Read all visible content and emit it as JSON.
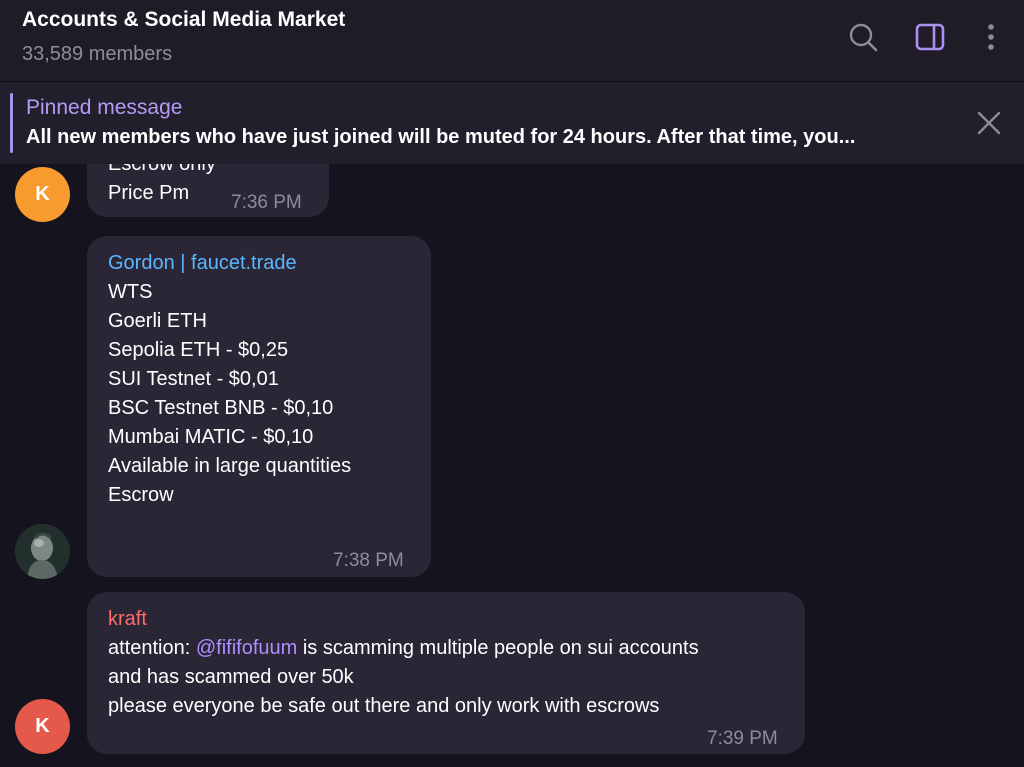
{
  "header": {
    "title": "Accounts & Social Media Market",
    "subtitle": "33,589 members"
  },
  "icons": {
    "search": "search-icon",
    "sidebar": "sidebar-toggle-icon",
    "more": "more-vertical-icon"
  },
  "colors": {
    "accent": "#a892f0",
    "sender_gordon": "#5cb6ff",
    "sender_kraft": "#ff6b6b",
    "mention": "#a891ff"
  },
  "pinned": {
    "title": "Pinned message",
    "text": "All new members who have just joined will be muted for 24 hours. After that time, you..."
  },
  "messages": [
    {
      "avatar": "K",
      "lines": [
        "Escrow only",
        "Price Pm"
      ],
      "time": "7:36 PM"
    },
    {
      "sender": "Gordon | faucet.trade",
      "lines": [
        "WTS",
        "",
        "Goerli ETH",
        "Sepolia ETH - $0,25",
        "SUI Testnet - $0,01",
        "BSC Testnet BNB - $0,10",
        "Mumbai MATIC - $0,10",
        "",
        "Available in large quantities",
        "Escrow"
      ],
      "time": "7:38 PM"
    },
    {
      "avatar": "K",
      "sender": "kraft",
      "line1_prefix": "attention: ",
      "mention": "@fififofuum",
      "line1_suffix": " is scamming multiple people on sui accounts",
      "line2": "and has scammed over 50k",
      "line3": "please everyone be safe out there and only work with escrows",
      "time": "7:39 PM"
    }
  ]
}
